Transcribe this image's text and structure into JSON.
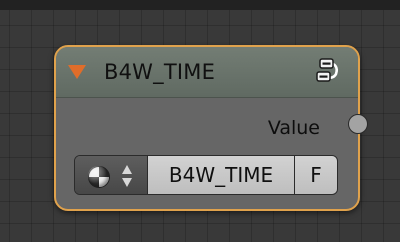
{
  "node": {
    "title": "B4W_TIME",
    "output_label": "Value",
    "selector": {
      "name": "B4W_TIME",
      "fake_user_label": "F"
    }
  },
  "colors": {
    "node_border": "#e0a24c",
    "collapse_arrow": "#e06d2a",
    "header": "#6d776e",
    "body": "#666666",
    "socket": "#a3a3a3",
    "editor_background": "#393939"
  },
  "icons": {
    "collapse": "triangle-down",
    "node_type": "node-group-icon",
    "browse": "material-ball-icon",
    "updown": "up-down-arrows-icon"
  }
}
